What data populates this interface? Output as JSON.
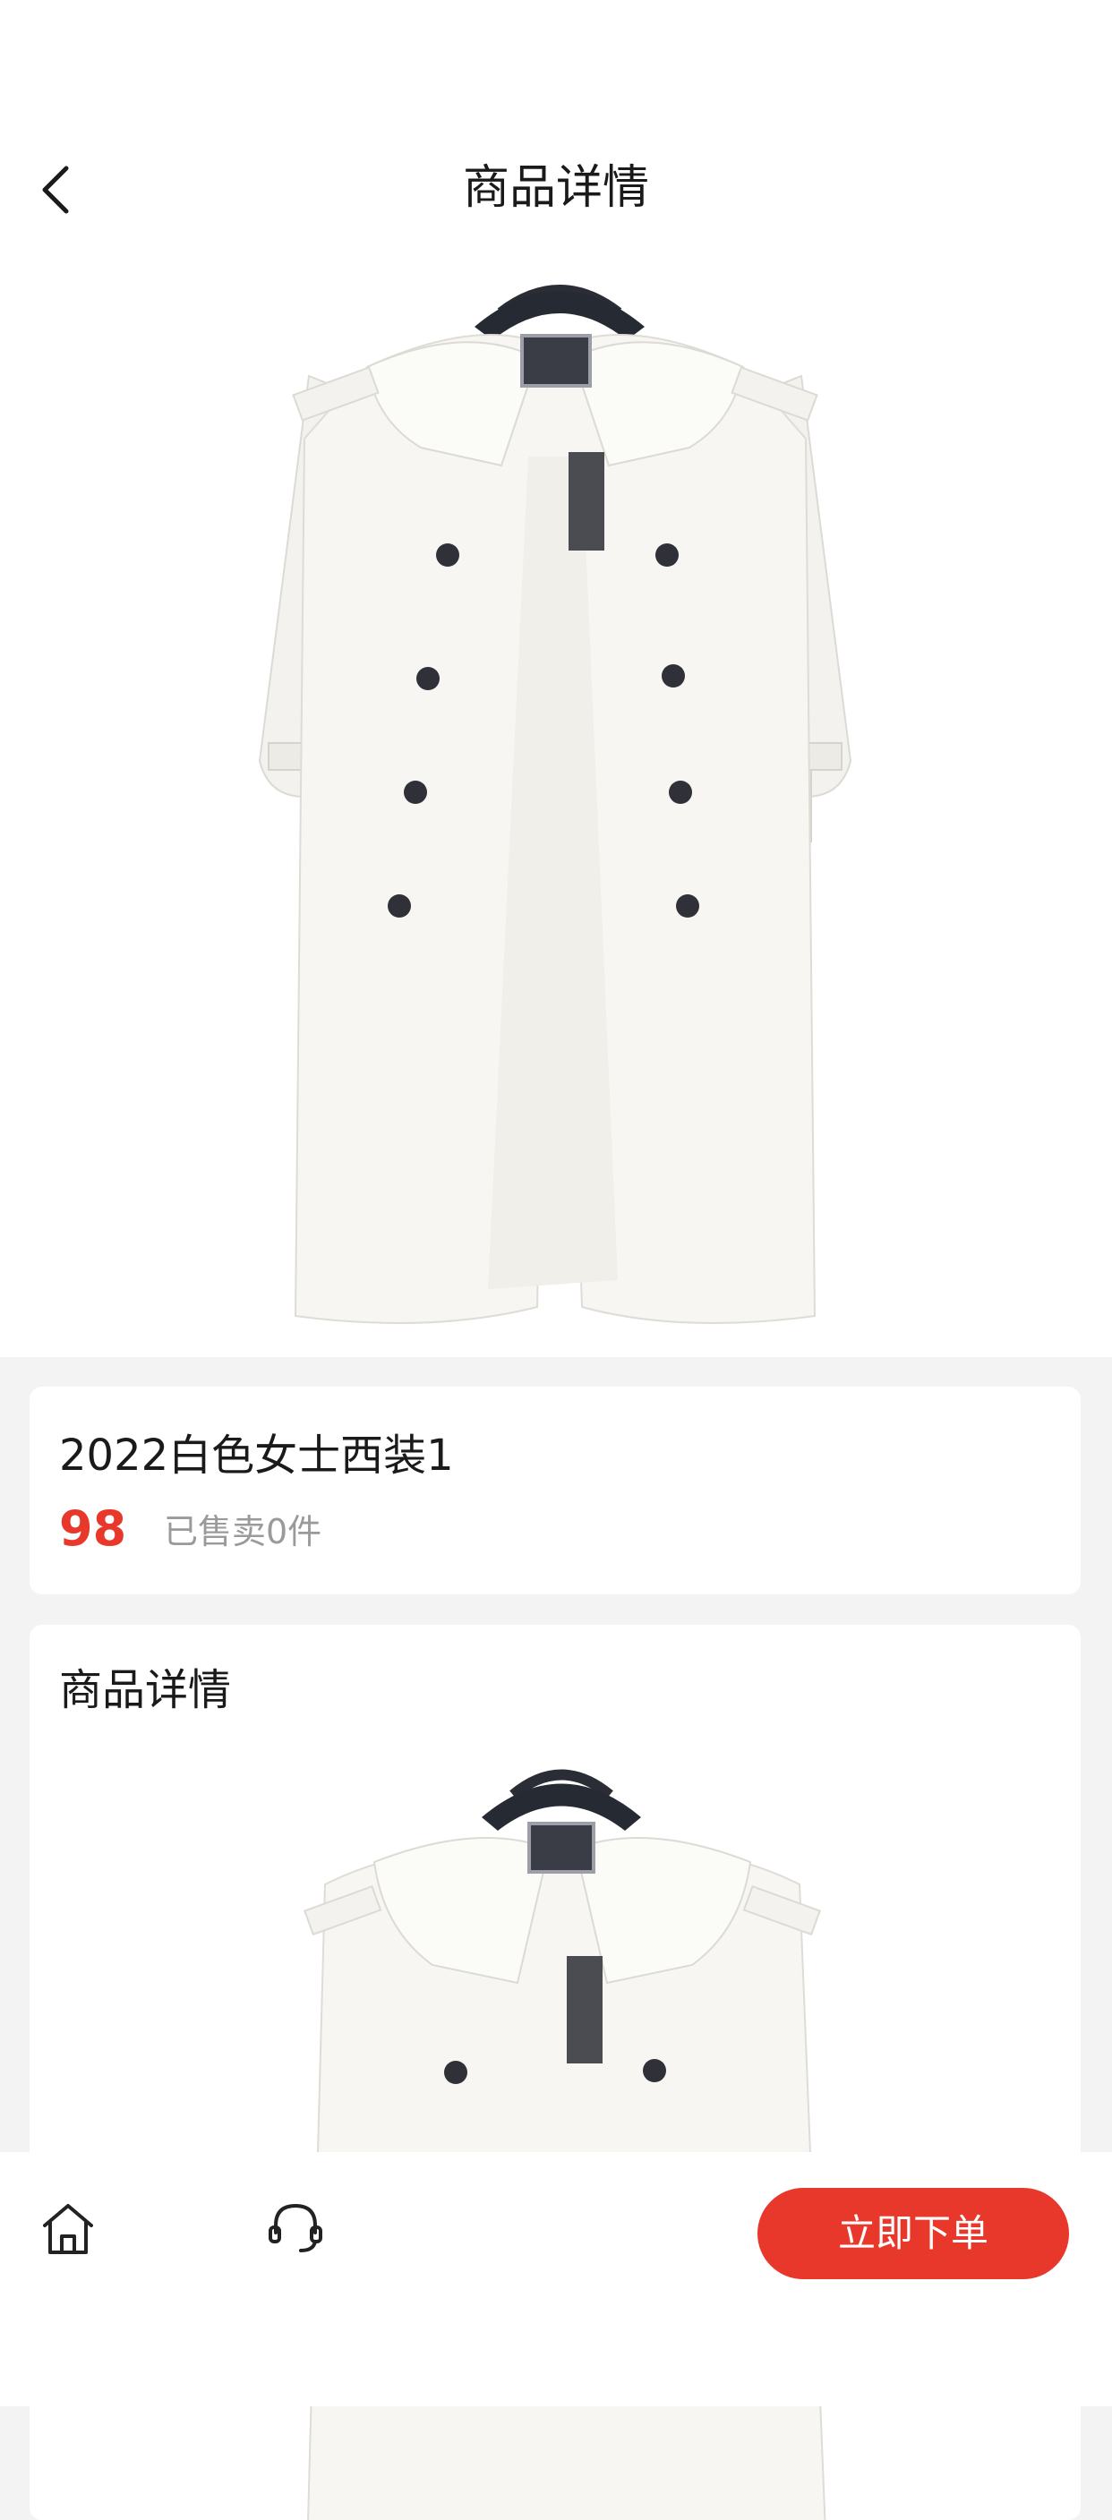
{
  "header": {
    "title": "商品详情",
    "back_icon": "chevron-left-icon"
  },
  "product": {
    "name": "2022白色女士西装1",
    "price": "98",
    "sold_text": "已售卖0件",
    "price_color": "#e8382b"
  },
  "detail": {
    "heading": "商品详情"
  },
  "bottom_bar": {
    "home_icon": "home-icon",
    "service_icon": "headset-icon",
    "order_label": "立即下单",
    "accent": "#e8382b"
  }
}
